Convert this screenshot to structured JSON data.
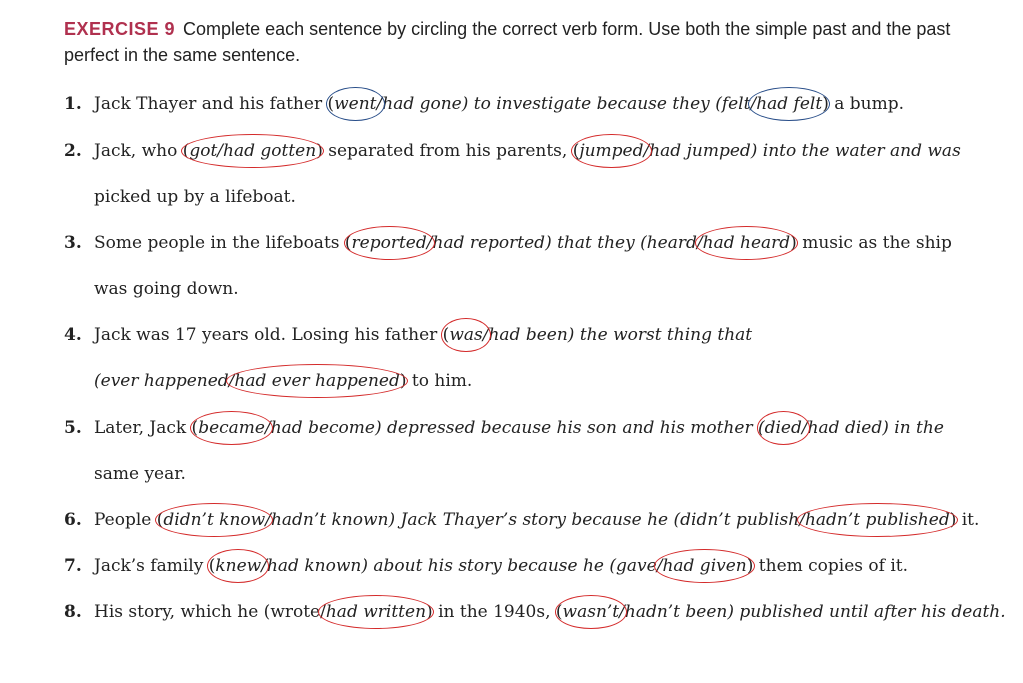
{
  "header": {
    "label": "EXERCISE 9",
    "instructions": "Complete each sentence by circling the correct verb form. Use both the simple past and the past perfect in the same sentence."
  },
  "items": [
    {
      "num": "1.",
      "p1": "Jack Thayer and his father (",
      "c1": "went",
      "p2": "/had gone) to investigate because they (",
      "p3": "felt/",
      "c2": "had felt",
      "p4": ") a bump."
    },
    {
      "num": "2.",
      "p1": "Jack, who (",
      "c1": "got/had gotten",
      "p2": ") separated from his parents, (",
      "c2": "jumped",
      "p3": "/had jumped) into the water and was",
      "cont": "picked up by a lifeboat."
    },
    {
      "num": "3.",
      "p1": "Some people in the lifeboats (",
      "c1": "reported",
      "p2": "/had reported) that they (heard/",
      "c2": "had heard",
      "p3": ") music as the ship",
      "cont": "was going down."
    },
    {
      "num": "4.",
      "p1": "Jack was 17 years old. Losing his father (",
      "c1": "was",
      "p2": "/had been) the worst thing that",
      "cont_p1": "(ever happened/",
      "cont_c1": "had ever happened",
      "cont_p2": ") to him."
    },
    {
      "num": "5.",
      "p1": "Later, Jack (",
      "c1": "became",
      "p2": "/had become) depressed because his son and his mother (",
      "c2": "died",
      "p3": "/had died) in the",
      "cont": "same year."
    },
    {
      "num": "6.",
      "p1": "People (",
      "c1": "didn’t know",
      "p2": "/hadn’t known) Jack Thayer’s story because he (didn’t publish/",
      "c2": "hadn’t published",
      "p3": ") it."
    },
    {
      "num": "7.",
      "p1": "Jack’s family (",
      "c1": "knew",
      "p2": "/had known) about his story because he (gave/",
      "c2": "had given",
      "p3": ") them copies of it."
    },
    {
      "num": "8.",
      "p1": "His story, which he (wrote/",
      "c1": "had written",
      "p2": ") in the 1940s, (",
      "c2": "wasn’t",
      "p3": "/hadn’t been) published until after his death."
    }
  ],
  "colors": {
    "accent": "#b0314f",
    "circle_red": "#d42b2b",
    "circle_blue": "#2a4f8a"
  }
}
